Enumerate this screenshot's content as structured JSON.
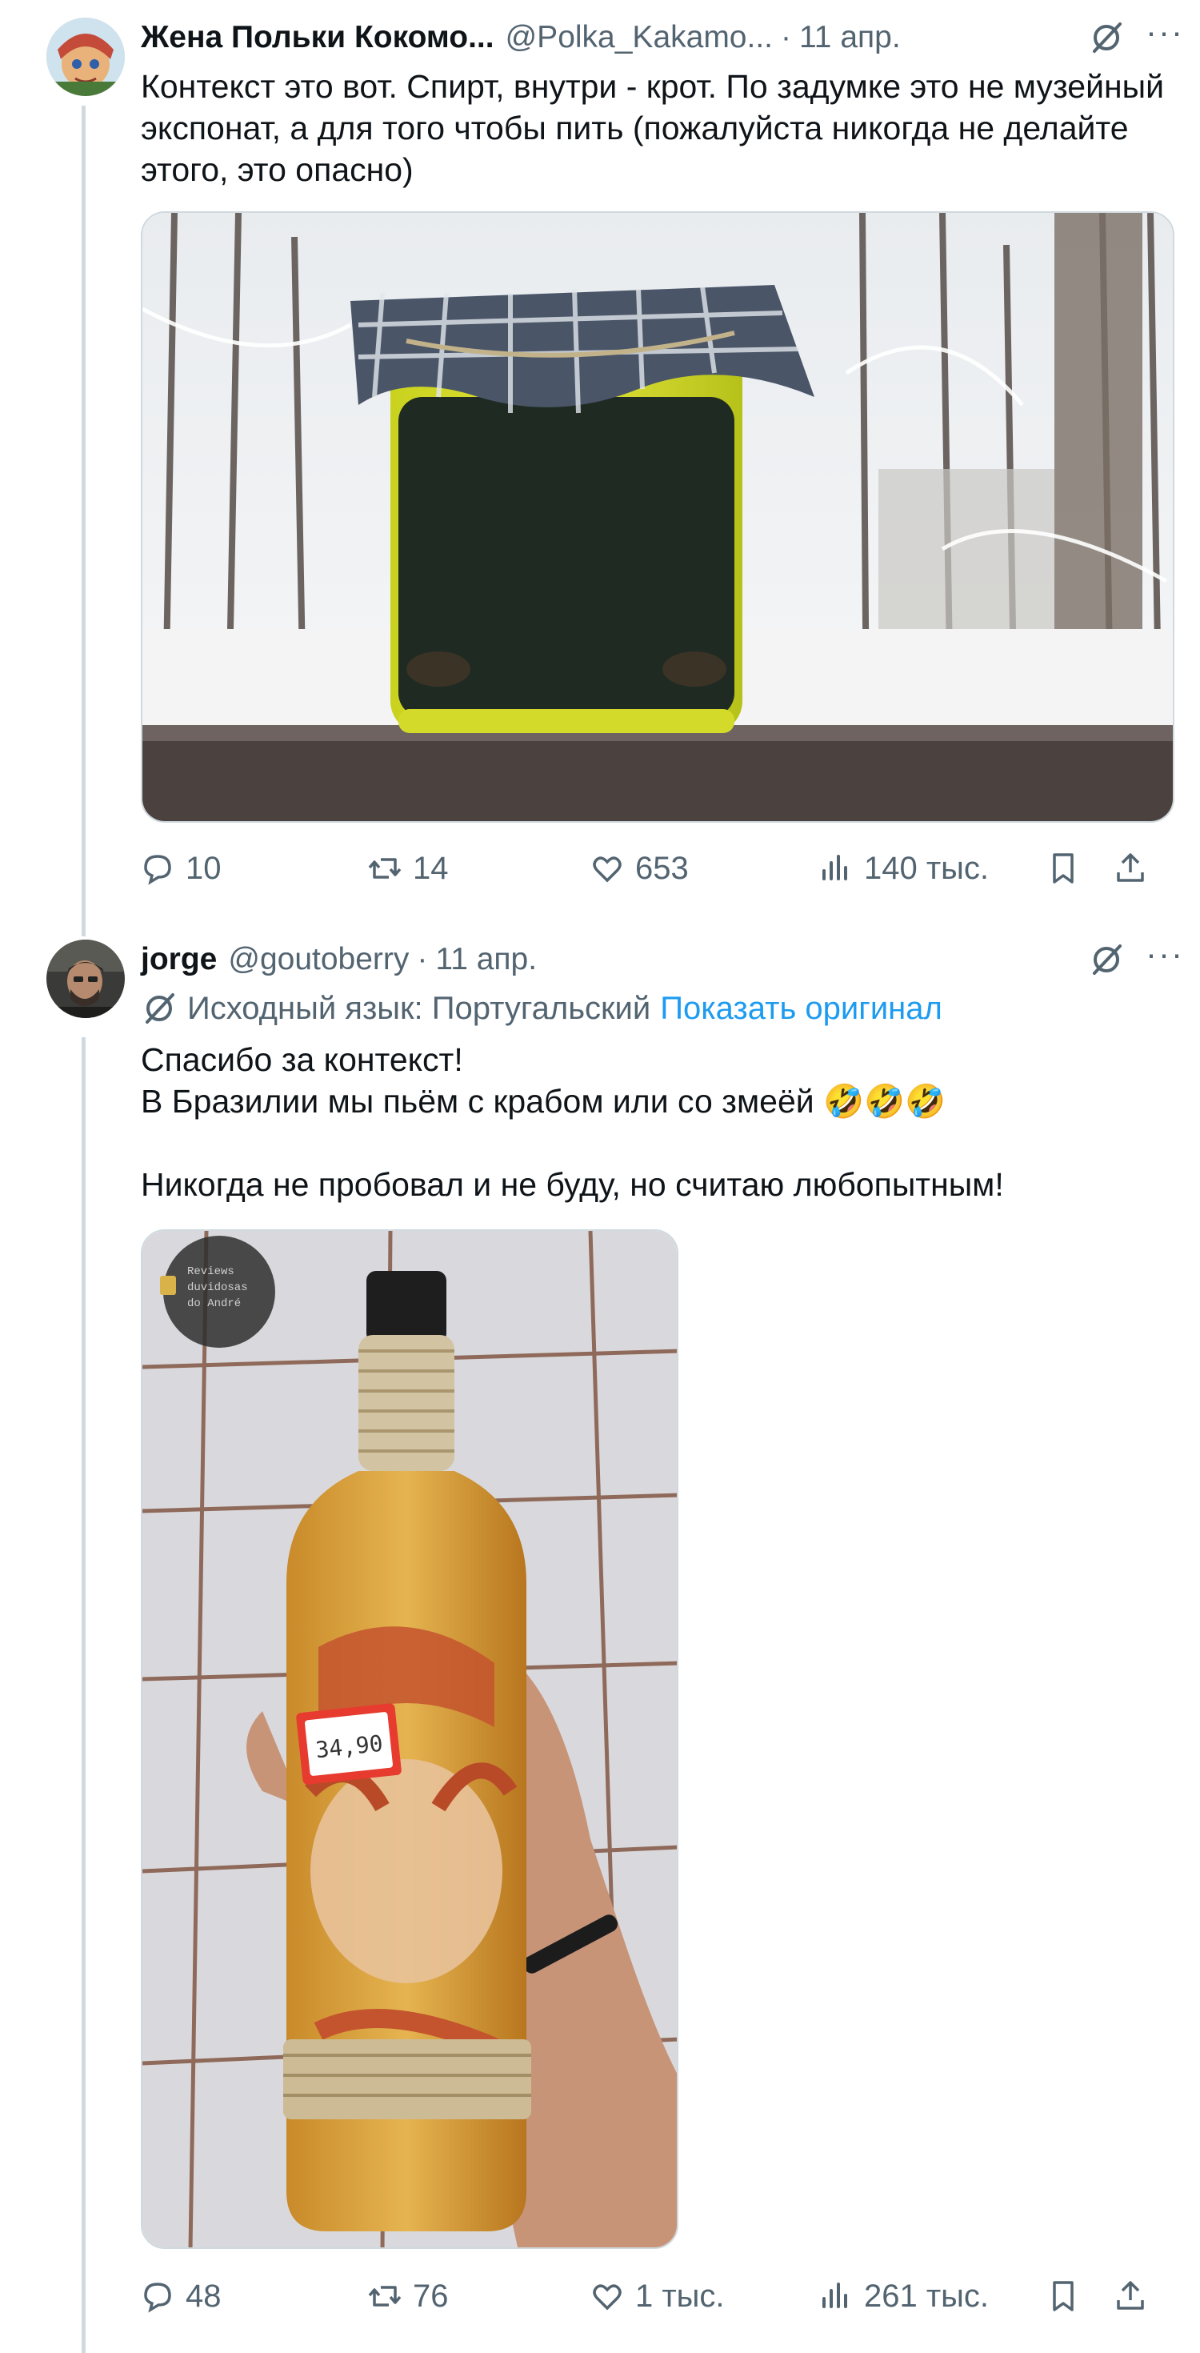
{
  "tweets": [
    {
      "author_name": "Жена Польки Кокомо...",
      "handle": "@Polka_Kakamo...",
      "separator": "·",
      "date": "11 апр.",
      "more": "···",
      "text": "Контекст это вот. Спирт, внутри - крот. По задумке это не музейный экспонат, а для того чтобы пить (пожалуйста никогда не делайте этого, это опасно)",
      "image_icon": "jar-with-mole-in-snow",
      "stats": {
        "replies": "10",
        "retweets": "14",
        "likes": "653",
        "views": "140 тыс."
      }
    },
    {
      "author_name": "jorge",
      "handle": "@goutoberry",
      "separator": "·",
      "date": "11 апр.",
      "more": "···",
      "translation_label": "Исходный язык: Португальский",
      "translation_link": "Показать оригинал",
      "text_lines": [
        "Спасибо за контекст!",
        "В Бразилии мы пьём с крабом или со змеёй 🤣🤣🤣",
        "",
        "Никогда не пробовал и не буду, но считаю любопытным!"
      ],
      "image_icon": "bottle-with-crab",
      "watermark_lines": [
        "Reviews",
        "duvidosas",
        "do André"
      ],
      "price_tag": "34,90",
      "stats": {
        "replies": "48",
        "retweets": "76",
        "likes": "1 тыс.",
        "views": "261 тыс."
      }
    }
  ],
  "colors": {
    "text": "#0f1419",
    "secondary": "#536471",
    "link": "#1d9bf0",
    "border": "#cfd9de"
  }
}
